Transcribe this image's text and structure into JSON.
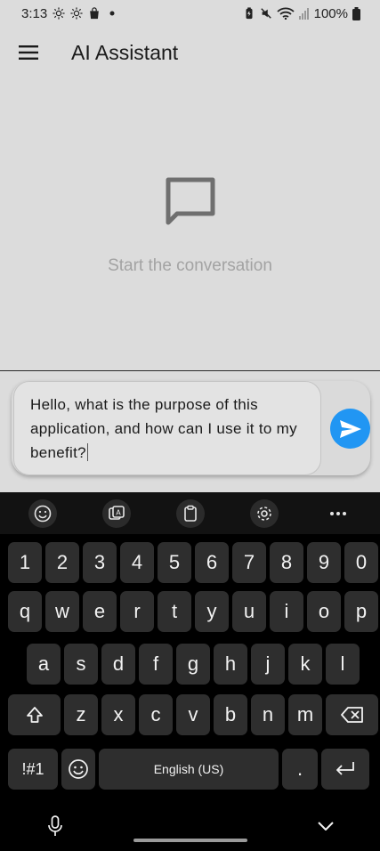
{
  "status_bar": {
    "time": "3:13",
    "battery": "100%",
    "left_icons": [
      "brightness-icon",
      "brightness-icon",
      "shopping-bag-icon",
      "dot-icon"
    ],
    "right_icons": [
      "battery-saver-icon",
      "mute-icon",
      "wifi-icon",
      "signal-icon",
      "battery-icon"
    ]
  },
  "app_bar": {
    "title": "AI Assistant",
    "menu_icon": "hamburger-menu-icon"
  },
  "empty_state": {
    "icon": "chat-bubble-icon",
    "text": "Start the conversation"
  },
  "composer": {
    "message": "Hello, what is the purpose of this application, and how can I use it to my benefit?",
    "send_icon": "send-icon"
  },
  "keyboard": {
    "toolbar": [
      "emoji-icon",
      "image-translate-icon",
      "clipboard-icon",
      "settings-icon",
      "more-icon"
    ],
    "digits": [
      "1",
      "2",
      "3",
      "4",
      "5",
      "6",
      "7",
      "8",
      "9",
      "0"
    ],
    "row_q": [
      "q",
      "w",
      "e",
      "r",
      "t",
      "y",
      "u",
      "i",
      "o",
      "p"
    ],
    "row_a": [
      "a",
      "s",
      "d",
      "f",
      "g",
      "h",
      "j",
      "k",
      "l"
    ],
    "row_z": [
      "z",
      "x",
      "c",
      "v",
      "b",
      "n",
      "m"
    ],
    "symbols_label": "!#1",
    "space_label": "English (US)",
    "dot_label": ".",
    "accent_color": "#2196f3"
  }
}
